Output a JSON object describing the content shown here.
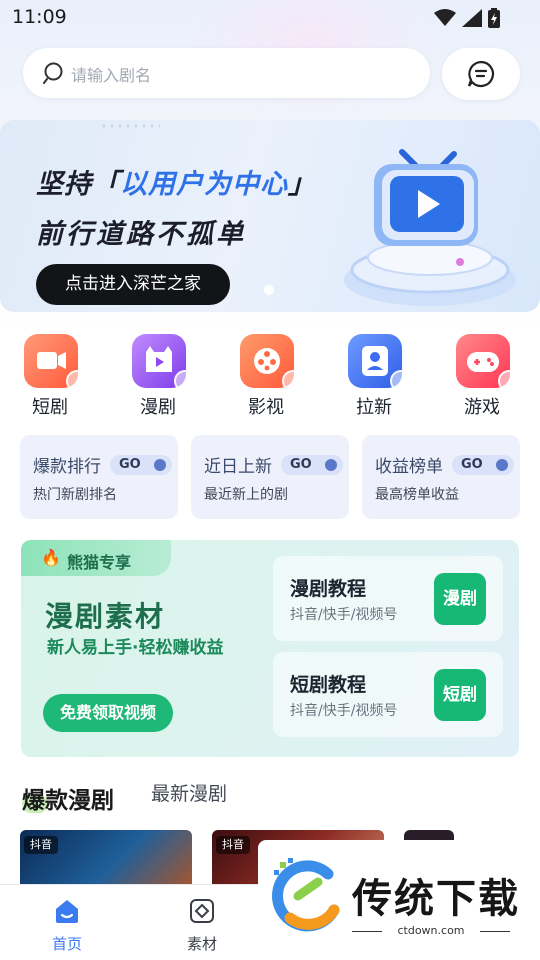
{
  "status_bar": {
    "time": "11:09"
  },
  "search": {
    "placeholder": "请输入剧名"
  },
  "banner": {
    "line1_a": "坚持「",
    "line1_highlight": "以用户为中心",
    "line1_b": "」",
    "line2": "前行道路不孤单",
    "cta": "点击进入深芒之家"
  },
  "categories": [
    {
      "label": "短剧",
      "icon": "video-camera-icon",
      "color": "#ff6e4a"
    },
    {
      "label": "漫剧",
      "icon": "cartoon-play-icon",
      "color": "#9d56f0"
    },
    {
      "label": "影视",
      "icon": "film-reel-icon",
      "color": "#ff6f45"
    },
    {
      "label": "拉新",
      "icon": "invite-user-icon",
      "color": "#3b6cf2"
    },
    {
      "label": "游戏",
      "icon": "gamepad-icon",
      "color": "#ff4a63"
    }
  ],
  "rank_cards": [
    {
      "title": "爆款排行",
      "go": "GO",
      "subtitle": "热门新剧排名"
    },
    {
      "title": "近日上新",
      "go": "GO",
      "subtitle": "最近新上的剧"
    },
    {
      "title": "收益榜单",
      "go": "GO",
      "subtitle": "最高榜单收益"
    }
  ],
  "promo": {
    "tag": "熊猫专享",
    "title": "漫剧素材",
    "subtitle": "新人易上手·轻松赚收益",
    "button": "免费领取视频",
    "tutorials": [
      {
        "title": "漫剧教程",
        "subtitle": "抖音/快手/视频号",
        "button": "漫剧"
      },
      {
        "title": "短剧教程",
        "subtitle": "抖音/快手/视频号",
        "button": "短剧"
      }
    ]
  },
  "sections": {
    "active": "爆款漫剧",
    "inactive": "最新漫剧"
  },
  "thumbs": [
    {
      "platform": "抖音"
    },
    {
      "platform": "抖音"
    }
  ],
  "bottom_nav": [
    {
      "label": "首页",
      "icon": "home-icon",
      "active": true
    },
    {
      "label": "素材",
      "icon": "material-icon",
      "active": false
    }
  ],
  "watermark": {
    "brand": "传统下载",
    "url": "ctdown.com"
  },
  "colors": {
    "accent": "#2f72e8",
    "green": "#1eb877",
    "nav_active": "#3b7bf0"
  }
}
